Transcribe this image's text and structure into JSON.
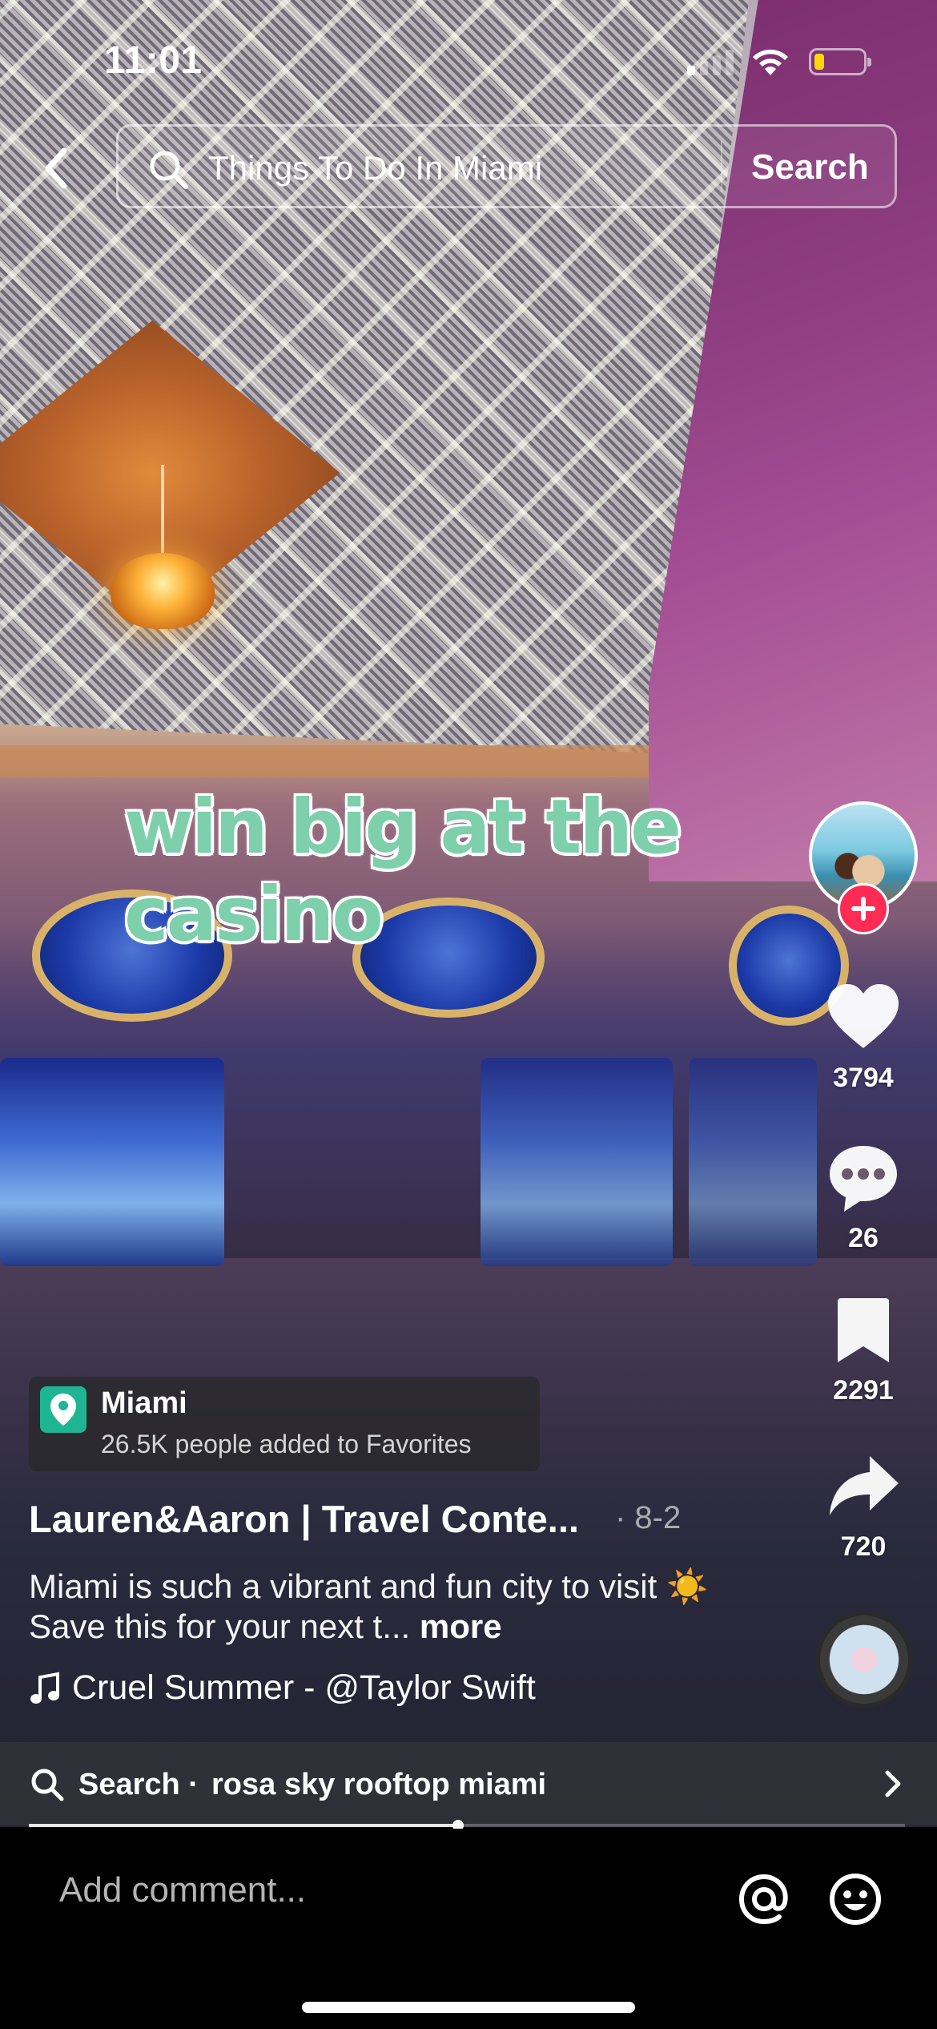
{
  "status_bar": {
    "time": "11:01",
    "battery_level": 0.2,
    "battery_color": "#ffd60a"
  },
  "search": {
    "query": "Things To Do In Miami",
    "button_label": "Search",
    "back_icon": "chevron-left-icon",
    "search_icon": "magnifier-icon"
  },
  "video": {
    "overlay_caption": "win big at the casino"
  },
  "rail": {
    "like_count": "3794",
    "comment_count": "26",
    "save_count": "2291",
    "share_count": "720",
    "follow_icon": "plus-icon",
    "accent_color": "#fe2c55"
  },
  "location": {
    "name": "Miami",
    "subtitle": "26.5K people added to Favorites",
    "pin_color": "#1fb592"
  },
  "post": {
    "author": "Lauren&Aaron | Travel Conte...",
    "date": "· 8-2",
    "description": "Miami is such a vibrant and fun city to visit ☀️  Save this for your next t...",
    "more_label": "more",
    "sound": "Cruel Summer - @Taylor Swift"
  },
  "related_search": {
    "label": "Search ·",
    "term": "rosa sky rooftop miami"
  },
  "playback": {
    "progress": 0.49
  },
  "comment_bar": {
    "placeholder": "Add comment...",
    "mention_icon": "at-icon",
    "emoji_icon": "smiley-icon"
  }
}
